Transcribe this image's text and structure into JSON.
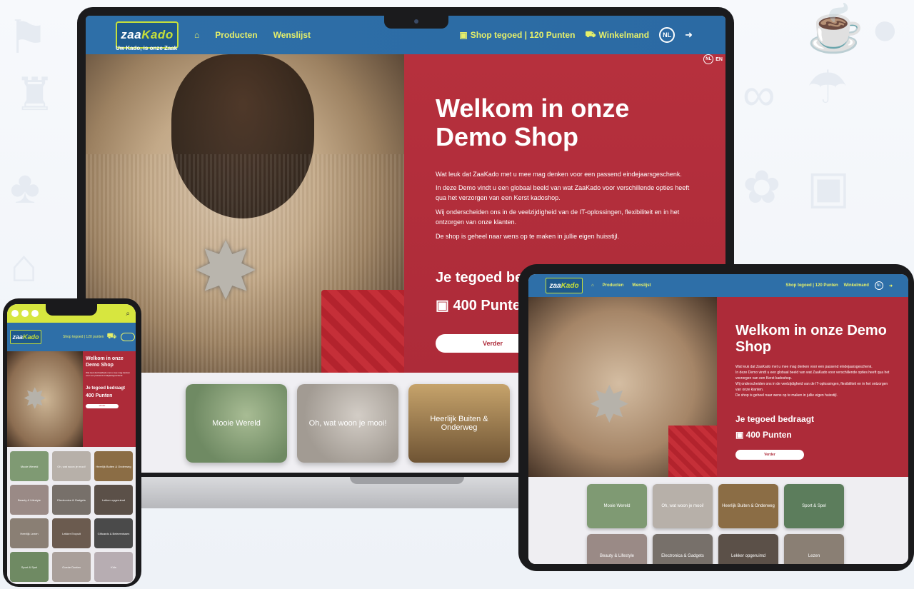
{
  "brand": {
    "name_left": "zaa",
    "name_right": "Kado",
    "tagline": "Uw Kado, is onze Zaak"
  },
  "nav": {
    "items": [
      {
        "label": "Producten"
      },
      {
        "label": "Wenslijst"
      }
    ],
    "credit_label": "Shop tegoed | 120 Punten",
    "cart_label": "Winkelmand",
    "lang_badge": "NL"
  },
  "lang_switch": {
    "nl": "NL",
    "en": "EN"
  },
  "hero": {
    "title": "Welkom in onze Demo Shop",
    "paragraphs": [
      "Wat leuk dat ZaaKado met u mee mag denken voor een passend eindejaarsgeschenk.",
      "In deze Demo vindt u een globaal beeld van wat ZaaKado voor verschillende opties heeft qua het verzorgen van een Kerst kadoshop.",
      "Wij onderscheiden ons in de veelzijdigheid van de IT-oplossingen, flexibiliteit en in het ontzorgen van onze klanten.",
      "De shop is geheel naar wens op te maken in jullie eigen huisstijl."
    ],
    "credit_title": "Je tegoed bedraagt",
    "credit_value": "400 Punten",
    "cta_label": "Verder"
  },
  "categories": [
    {
      "label": "Mooie Wereld",
      "color": "#7f9a73"
    },
    {
      "label": "Oh, wat woon je mooi!",
      "color": "#b7b0a9"
    },
    {
      "label": "Heerlijk Buiten & Onderweg",
      "color": "#8b6d45"
    },
    {
      "label": "Sport & Spel",
      "color": "#5c7d5c"
    },
    {
      "label": "Beauty & Lifestyle",
      "color": "#9a8a86"
    },
    {
      "label": "Electronica & Gadgets",
      "color": "#77706a"
    },
    {
      "label": "Lekker opgeruimd",
      "color": "#5b5048"
    },
    {
      "label": "Lezen",
      "color": "#8a7f74"
    }
  ],
  "phone": {
    "credit_label": "Shop tegoed | 120 punten",
    "title": "Welkom in onze Demo Shop",
    "credit_title": "Je tegoed bedraagt",
    "credit_value": "400 Punten",
    "cta_label": "Verder",
    "tiles": [
      {
        "label": "Mooie Wereld",
        "color": "#7f9a73"
      },
      {
        "label": "Oh, wat woon je mooi!",
        "color": "#b7b0a9"
      },
      {
        "label": "Heerlijk Buiten & Onderweg",
        "color": "#8b6d45"
      },
      {
        "label": "Beauty & Lifestyle",
        "color": "#9a8a86"
      },
      {
        "label": "Electronica & Gadgets",
        "color": "#77706a"
      },
      {
        "label": "Lekker opgeruimd",
        "color": "#5b5048"
      },
      {
        "label": "Heerlijk Lezen",
        "color": "#8a7f74"
      },
      {
        "label": "Lekker Eropuit",
        "color": "#6b5b4f"
      },
      {
        "label": "Giftcards & Belevenissen",
        "color": "#4a4a4a"
      },
      {
        "label": "Sport & Spel",
        "color": "#6f8a63"
      },
      {
        "label": "Goede Doelen",
        "color": "#a99f9a"
      },
      {
        "label": "Kids",
        "color": "#b7adb2"
      }
    ]
  },
  "colors": {
    "nav_blue": "#2e6fa8",
    "accent_yellow": "#e6f06a",
    "hero_red": "#ad2b39",
    "phone_header": "#d7e63f"
  }
}
